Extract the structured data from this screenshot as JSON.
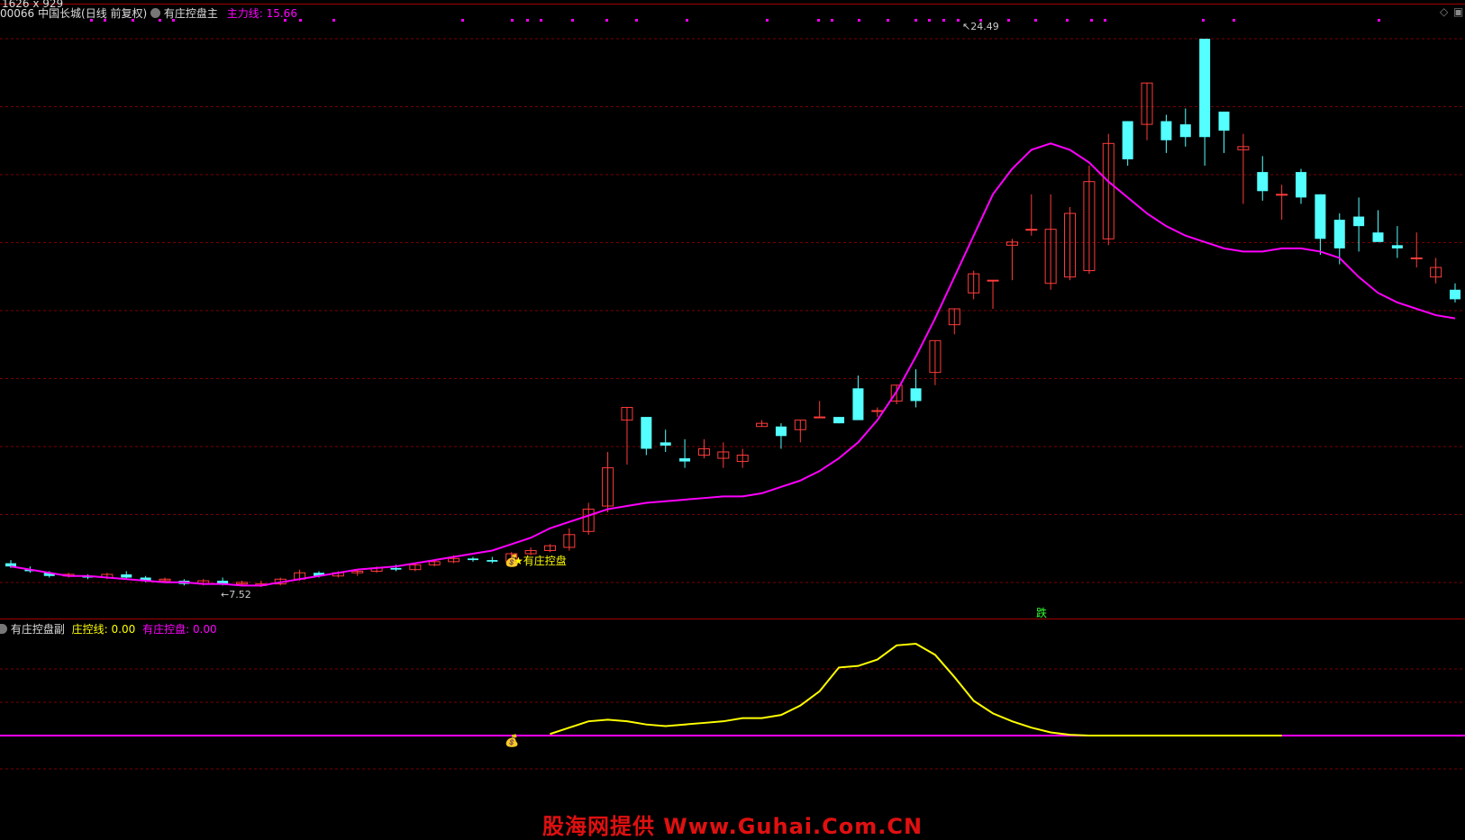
{
  "window": {
    "dims_label": "1626 x 929"
  },
  "main_header": {
    "code": "00066",
    "name": "中国长城",
    "period": "(日线 前复权)",
    "indicator": "有庄控盘主",
    "line_label": "主力线:",
    "line_value": "15.66"
  },
  "sub_header": {
    "indicator": "有庄控盘副",
    "l1_label": "庄控线:",
    "l1_value": "0.00",
    "l2_label": "有庄控盘:",
    "l2_value": "0.00"
  },
  "annotations": {
    "high": "24.49",
    "low": "7.52",
    "signal": "★有庄控盘",
    "fall": "跌"
  },
  "watermark": "股海网提供 Www.Guhai.Com.CN",
  "colors": {
    "up": "#ff3b3b",
    "down": "#54ffff",
    "main_line": "#ff00ff",
    "sub_line": "#ffff00",
    "grid": "#7a0000",
    "divider": "#a00000"
  },
  "chart_data": {
    "type": "candlestick",
    "series": [
      {
        "name": "主力线",
        "values": [
          7.9,
          7.8,
          7.7,
          7.6,
          7.6,
          7.55,
          7.5,
          7.45,
          7.4,
          7.4,
          7.35,
          7.35,
          7.3,
          7.3,
          7.4,
          7.5,
          7.6,
          7.7,
          7.8,
          7.85,
          7.9,
          8.0,
          8.1,
          8.2,
          8.3,
          8.4,
          8.6,
          8.8,
          9.1,
          9.3,
          9.5,
          9.7,
          9.8,
          9.9,
          9.95,
          10.0,
          10.05,
          10.1,
          10.1,
          10.2,
          10.4,
          10.6,
          10.9,
          11.3,
          11.8,
          12.5,
          13.4,
          14.5,
          15.7,
          17.0,
          18.3,
          19.6,
          20.4,
          21.0,
          21.2,
          21.0,
          20.6,
          20.0,
          19.5,
          19.0,
          18.6,
          18.3,
          18.1,
          17.9,
          17.8,
          17.8,
          17.9,
          17.9,
          17.8,
          17.6,
          17.0,
          16.5,
          16.2,
          16.0,
          15.8,
          15.7
        ]
      },
      {
        "name": "庄控线",
        "values": [
          0,
          0,
          0,
          0,
          0,
          0,
          0,
          0,
          0,
          0,
          0,
          0,
          0,
          0,
          0,
          0,
          0,
          0,
          0,
          0,
          0,
          0,
          0,
          0,
          0,
          0,
          0,
          0,
          0.1,
          0.5,
          0.9,
          1.0,
          0.9,
          0.7,
          0.6,
          0.7,
          0.8,
          0.9,
          1.1,
          1.1,
          1.3,
          1.9,
          2.8,
          4.3,
          4.4,
          4.8,
          5.7,
          5.8,
          5.1,
          3.7,
          2.2,
          1.4,
          0.9,
          0.5,
          0.2,
          0.05,
          0,
          0,
          0,
          0,
          0,
          0,
          0,
          0,
          0,
          0,
          0,
          0,
          0,
          0,
          0,
          0,
          0,
          0,
          0,
          0
        ]
      },
      {
        "name": "有庄控盘",
        "values": [
          0,
          0,
          0,
          0,
          0,
          0,
          0,
          0,
          0,
          0,
          0,
          0,
          0,
          0,
          0,
          0,
          0,
          0,
          0,
          0,
          0,
          0,
          0,
          0,
          0,
          0,
          0,
          0,
          0,
          0,
          0,
          0,
          0,
          0,
          0,
          0,
          0,
          0,
          0,
          0,
          0,
          0,
          0,
          0,
          0,
          0,
          0,
          0,
          0,
          0,
          0,
          0,
          0,
          0,
          0,
          0,
          0,
          0,
          0,
          0,
          0,
          0,
          0,
          0,
          0,
          0,
          0,
          0,
          0,
          0,
          0,
          0,
          0,
          0,
          0,
          0
        ]
      }
    ],
    "ohlc": [
      [
        8.0,
        8.1,
        7.85,
        7.9
      ],
      [
        7.8,
        7.9,
        7.7,
        7.75
      ],
      [
        7.7,
        7.75,
        7.55,
        7.6
      ],
      [
        7.6,
        7.7,
        7.55,
        7.65
      ],
      [
        7.6,
        7.65,
        7.5,
        7.55
      ],
      [
        7.55,
        7.7,
        7.5,
        7.65
      ],
      [
        7.65,
        7.75,
        7.5,
        7.55
      ],
      [
        7.55,
        7.6,
        7.4,
        7.45
      ],
      [
        7.45,
        7.55,
        7.4,
        7.5
      ],
      [
        7.45,
        7.5,
        7.3,
        7.35
      ],
      [
        7.35,
        7.5,
        7.3,
        7.45
      ],
      [
        7.45,
        7.55,
        7.3,
        7.35
      ],
      [
        7.35,
        7.45,
        7.3,
        7.4
      ],
      [
        7.3,
        7.45,
        7.25,
        7.35
      ],
      [
        7.35,
        7.55,
        7.3,
        7.5
      ],
      [
        7.5,
        7.8,
        7.45,
        7.7
      ],
      [
        7.7,
        7.75,
        7.55,
        7.6
      ],
      [
        7.6,
        7.75,
        7.55,
        7.7
      ],
      [
        7.7,
        7.8,
        7.6,
        7.75
      ],
      [
        7.75,
        7.9,
        7.7,
        7.85
      ],
      [
        7.85,
        7.95,
        7.75,
        7.8
      ],
      [
        7.8,
        8.0,
        7.75,
        7.95
      ],
      [
        7.95,
        8.1,
        7.9,
        8.05
      ],
      [
        8.05,
        8.25,
        8.0,
        8.15
      ],
      [
        8.15,
        8.2,
        8.05,
        8.1
      ],
      [
        8.1,
        8.2,
        8.0,
        8.05
      ],
      [
        8.05,
        8.35,
        8.0,
        8.3
      ],
      [
        8.3,
        8.5,
        8.25,
        8.4
      ],
      [
        8.4,
        8.6,
        8.35,
        8.55
      ],
      [
        8.5,
        9.1,
        8.4,
        8.9
      ],
      [
        9.0,
        9.9,
        8.9,
        9.7
      ],
      [
        9.8,
        11.5,
        9.6,
        11.0
      ],
      [
        12.5,
        12.9,
        11.1,
        12.9
      ],
      [
        12.6,
        11.4,
        12.6,
        11.6
      ],
      [
        11.8,
        12.2,
        11.5,
        11.7
      ],
      [
        11.3,
        11.9,
        11.0,
        11.2
      ],
      [
        11.4,
        11.9,
        11.3,
        11.6
      ],
      [
        11.3,
        11.8,
        11.0,
        11.5
      ],
      [
        11.2,
        11.6,
        11.0,
        11.4
      ],
      [
        12.3,
        12.5,
        12.3,
        12.4
      ],
      [
        12.3,
        12.4,
        11.6,
        12.0
      ],
      [
        12.2,
        12.5,
        11.8,
        12.5
      ],
      [
        12.6,
        13.1,
        12.6,
        12.6
      ],
      [
        12.6,
        12.5,
        12.4,
        12.4
      ],
      [
        13.5,
        13.9,
        12.6,
        12.5
      ],
      [
        12.8,
        12.9,
        12.6,
        12.8
      ],
      [
        13.1,
        13.6,
        13.0,
        13.6
      ],
      [
        13.5,
        14.1,
        12.9,
        13.1
      ],
      [
        14.0,
        15.0,
        13.6,
        15.0
      ],
      [
        15.5,
        16.0,
        15.2,
        16.0
      ],
      [
        16.5,
        17.2,
        16.3,
        17.1
      ],
      [
        16.9,
        16.9,
        16.0,
        16.9
      ],
      [
        18.0,
        18.2,
        16.9,
        18.1
      ],
      [
        18.5,
        19.6,
        18.3,
        18.5
      ],
      [
        16.8,
        19.6,
        16.6,
        18.5
      ],
      [
        17.0,
        19.2,
        16.9,
        19.0
      ],
      [
        17.2,
        20.5,
        17.1,
        20.0
      ],
      [
        18.2,
        21.5,
        18.0,
        21.2
      ],
      [
        21.9,
        21.9,
        20.5,
        20.7
      ],
      [
        21.8,
        23.1,
        21.3,
        23.1
      ],
      [
        21.9,
        22.1,
        20.9,
        21.3
      ],
      [
        21.8,
        22.3,
        21.1,
        21.4
      ],
      [
        24.49,
        24.49,
        20.5,
        21.4
      ],
      [
        22.2,
        22.2,
        20.9,
        21.6
      ],
      [
        21.0,
        21.5,
        19.3,
        21.1
      ],
      [
        20.3,
        20.8,
        19.4,
        19.7
      ],
      [
        19.6,
        19.9,
        18.8,
        19.6
      ],
      [
        20.3,
        20.4,
        19.3,
        19.5
      ],
      [
        19.6,
        19.6,
        17.7,
        18.2
      ],
      [
        18.8,
        19.0,
        17.4,
        17.9
      ],
      [
        18.9,
        19.5,
        17.8,
        18.6
      ],
      [
        18.4,
        19.1,
        18.3,
        18.1
      ],
      [
        18.0,
        18.6,
        17.6,
        17.9
      ],
      [
        17.6,
        18.4,
        17.3,
        17.6
      ],
      [
        17.0,
        17.6,
        16.8,
        17.3
      ],
      [
        16.6,
        16.8,
        16.2,
        16.3
      ]
    ]
  }
}
